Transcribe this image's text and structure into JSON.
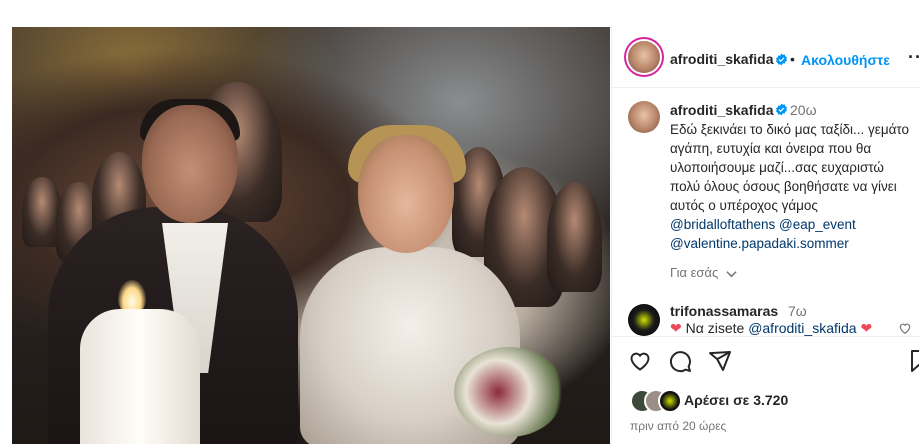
{
  "post": {
    "author": "afroditi_skafida",
    "follow_label": "Ακολουθήστε",
    "dot": "•",
    "more": "···"
  },
  "caption": {
    "author": "afroditi_skafida",
    "time": "20ω",
    "text": "Εδώ ξεκινάει το δικό μας ταξίδι... γεμάτο αγάπη, ευτυχία και όνειρα που θα υλοποιήσουμε μαζί...σας ευχαριστώ πολύ όλους όσους βοηθήσατε να γίνει αυτός ο υπέροχος γάμος",
    "tags": [
      "@bridalloftathens @eap_event",
      "@valentine.papadaki.sommer"
    ]
  },
  "for_you": "Για εσάς",
  "comment": {
    "author": "trifonassamaras",
    "time": "7ω",
    "text_prefix": "Να zisete ",
    "mention": "@afroditi_skafida"
  },
  "likes": {
    "label": "Αρέσει σε 3.720"
  },
  "posted_ago": "πριν από 20 ώρες",
  "colors": {
    "accent": "#0095f6",
    "heart": "#ed4956",
    "link": "#00376b",
    "verified": "#0095f6"
  },
  "icons": [
    "verified-icon",
    "heart-icon",
    "comment-icon",
    "share-icon",
    "bookmark-icon",
    "chevron-down-icon",
    "more-icon"
  ]
}
